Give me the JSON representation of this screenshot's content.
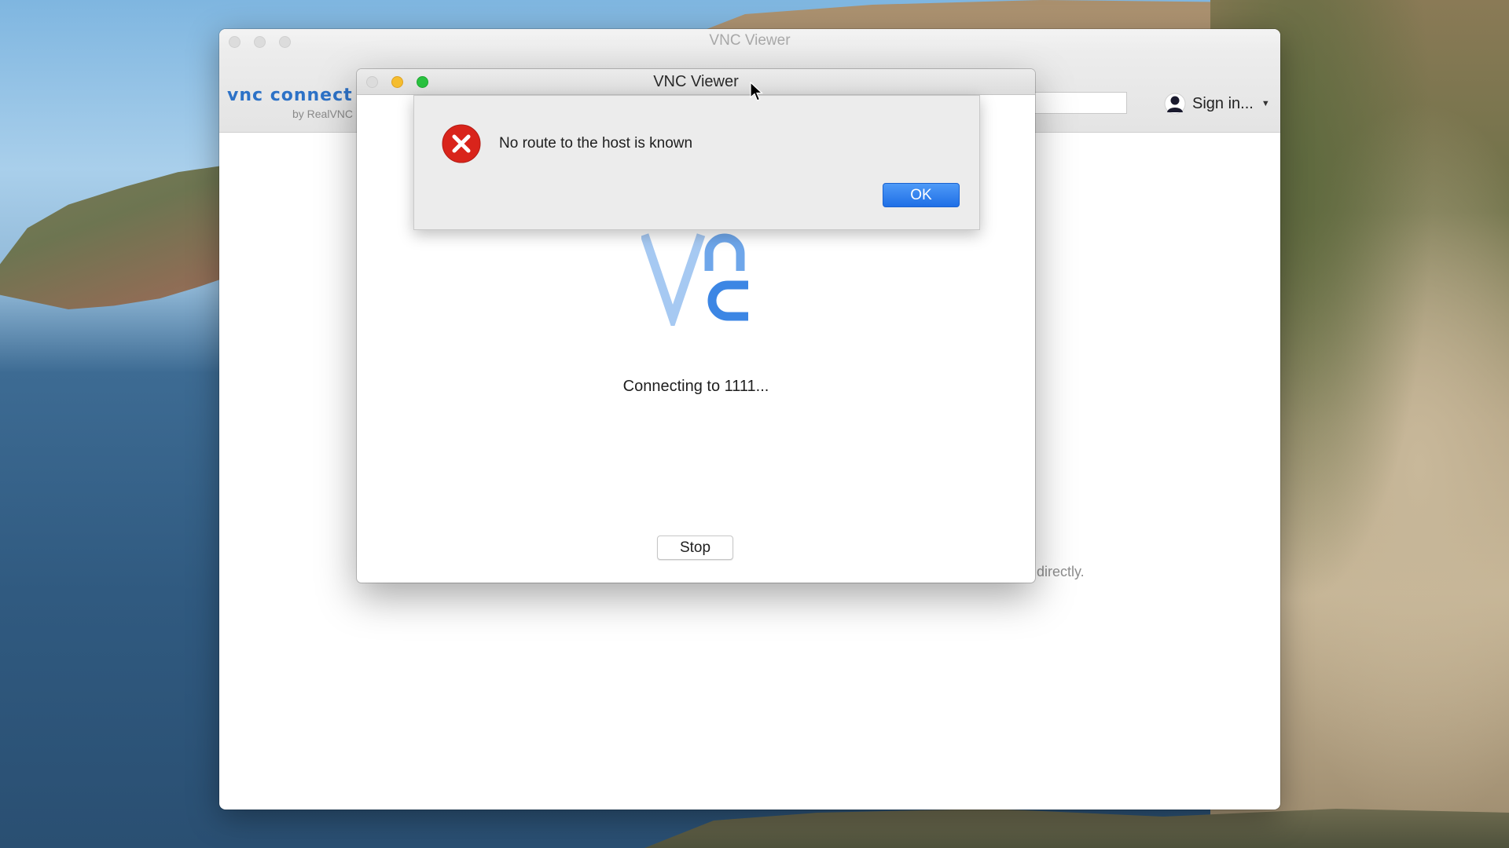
{
  "main_window": {
    "title": "VNC Viewer",
    "brand_name": "vnc connect",
    "brand_sub": "by RealVNC",
    "signin_label": "Sign in...",
    "hint_text": "directly."
  },
  "connection_window": {
    "title": "VNC Viewer",
    "status_text": "Connecting to 1111...",
    "stop_label": "Stop"
  },
  "alert": {
    "message": "No route to the host is known",
    "ok_label": "OK",
    "icon": "error-icon"
  },
  "colors": {
    "accent_blue": "#1f6fe6",
    "error_red": "#d9241b",
    "brand_blue": "#2d72c7"
  }
}
